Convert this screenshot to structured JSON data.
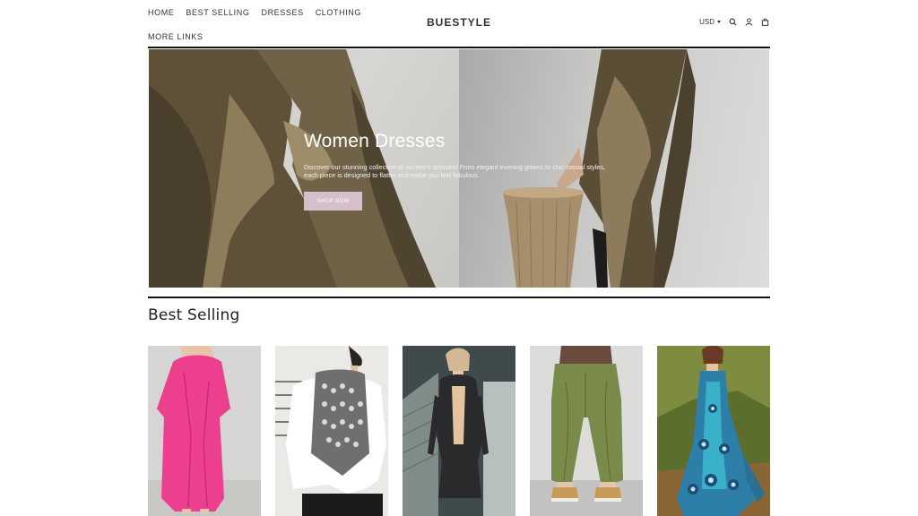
{
  "header": {
    "brand": "BUESTYLE",
    "nav": [
      {
        "label": "HOME"
      },
      {
        "label": "BEST SELLING"
      },
      {
        "label": "DRESSES"
      },
      {
        "label": "CLOTHING"
      },
      {
        "label": "MORE LINKS"
      }
    ],
    "currency": "USD",
    "icons": [
      "search-icon",
      "account-icon",
      "cart-icon"
    ]
  },
  "hero": {
    "title": "Women Dresses",
    "description": "Discover our stunning collection of women's dresses! From elegant evening gowns to chic casual styles, each piece is designed to flatter and make you feel fabulous.",
    "button_label": "SHOP NOW",
    "button_color": "#d4bfca"
  },
  "best_selling": {
    "title": "Best Selling",
    "products": [
      {
        "image": "pink-maxi-dress"
      },
      {
        "image": "patterned-vest-white-shirt"
      },
      {
        "image": "black-sequin-backless-dress"
      },
      {
        "image": "olive-wide-leg-pants"
      },
      {
        "image": "blue-peacock-print-maxi-dress"
      }
    ]
  },
  "colors": {
    "rule": "#111111",
    "text": "#222222"
  }
}
